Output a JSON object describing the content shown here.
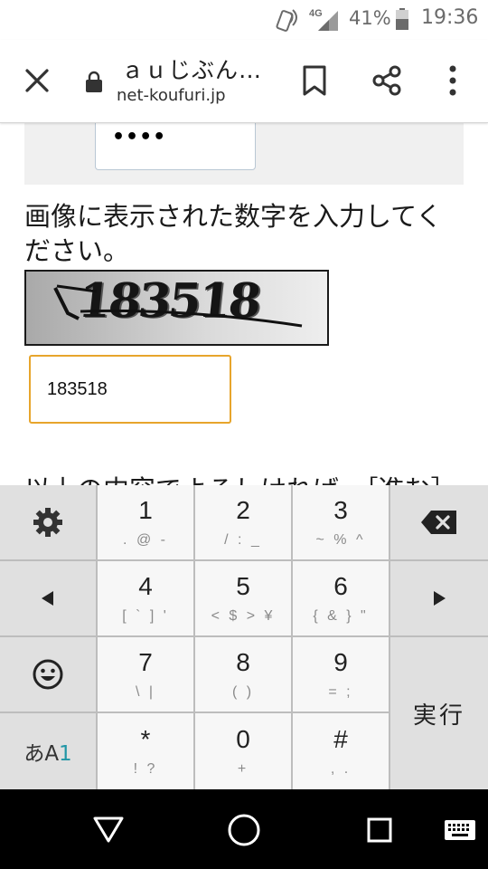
{
  "status_bar": {
    "network": "4G",
    "battery": "41%",
    "time": "19:36"
  },
  "toolbar": {
    "title": "ａｕじぶん…",
    "url": "net-koufuri.jp"
  },
  "form": {
    "password_mask": "••••",
    "instruction": "画像に表示された数字を入力してください。",
    "captcha_text": "183518",
    "answer_value": "183518",
    "cut_text": "以上の内容でよろしければ、［進む］"
  },
  "keyboard": {
    "keys": [
      {
        "main": "1",
        "sub": ". @ -"
      },
      {
        "main": "2",
        "sub": "/ : _"
      },
      {
        "main": "3",
        "sub": "~ % ^"
      },
      {
        "main": "4",
        "sub": "[ ` ] '"
      },
      {
        "main": "5",
        "sub": "< $ > ¥"
      },
      {
        "main": "6",
        "sub": "{ & } \""
      },
      {
        "main": "7",
        "sub": "\\ |"
      },
      {
        "main": "8",
        "sub": "( )"
      },
      {
        "main": "9",
        "sub": "= ;"
      },
      {
        "main": "*",
        "sub": "! ?"
      },
      {
        "main": "0",
        "sub": "+"
      },
      {
        "main": "#",
        "sub": ", ."
      }
    ],
    "enter_label": "実行",
    "ime_label_a": "あA",
    "ime_label_num": "1",
    "icons": {
      "settings": "gear-icon",
      "left": "left-arrow-icon",
      "right": "right-arrow-icon",
      "emoji": "emoji-icon",
      "backspace": "backspace-icon"
    }
  },
  "colors": {
    "field_focus_border": "#e7a52c",
    "ime_accent": "#2196a6"
  }
}
